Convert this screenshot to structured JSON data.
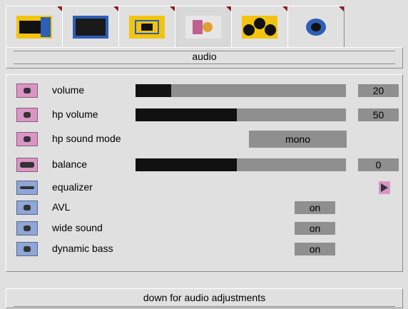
{
  "tabs": [
    {
      "icon": "picture-mode-icon"
    },
    {
      "icon": "screen-icon"
    },
    {
      "icon": "aspect-icon"
    },
    {
      "icon": "audio-icon"
    },
    {
      "icon": "features-icon"
    },
    {
      "icon": "setup-icon"
    }
  ],
  "header": {
    "title": "audio"
  },
  "rows": {
    "volume": {
      "label": "volume",
      "value": "20",
      "level": 0.17
    },
    "hp_volume": {
      "label": "hp volume",
      "value": "50",
      "level": 0.48
    },
    "hp_sound_mode": {
      "label": "hp sound mode",
      "value": "mono"
    },
    "balance": {
      "label": "balance",
      "value": "0",
      "level": 0.48
    },
    "equalizer": {
      "label": "equalizer"
    },
    "avl": {
      "label": "AVL",
      "value": "on"
    },
    "wide_sound": {
      "label": "wide sound",
      "value": "on"
    },
    "dynamic_bass": {
      "label": "dynamic bass",
      "value": "on"
    }
  },
  "footer": {
    "hint": "down for audio adjustments"
  },
  "colors": {
    "accent": "#f2c40f",
    "track": "#8f8f8f",
    "fill": "#111111",
    "tab_marker": "#8a1a1a"
  }
}
